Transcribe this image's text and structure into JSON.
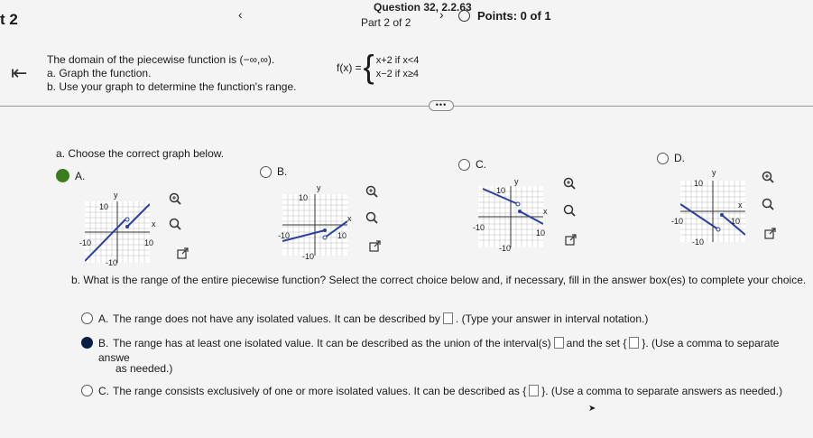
{
  "header": {
    "part_left": "t 2",
    "question": "Question 32, 2.2.63",
    "prev": "‹",
    "next": "›",
    "part": "Part 2 of 2",
    "points": "Points: 0 of 1"
  },
  "problem": {
    "line1": "The domain of the piecewise function is (−∞,∞).",
    "line2": "a. Graph the function.",
    "line3": "b. Use your graph to determine the function's range.",
    "fx": "f(x) =",
    "case1": "x+2  if  x<4",
    "case2": "x−2  if  x≥4"
  },
  "part_a": {
    "prompt": "a. Choose the correct graph below.",
    "options": [
      {
        "label": "A.",
        "state": "correct"
      },
      {
        "label": "B.",
        "state": "none"
      },
      {
        "label": "C.",
        "state": "none"
      },
      {
        "label": "D.",
        "state": "none"
      }
    ],
    "axis_y": "y",
    "axis_x": "x",
    "tick_pos": "10",
    "tick_neg": "-10"
  },
  "part_b": {
    "prompt": "b. What is the range of the entire piecewise function? Select the correct choice below and, if necessary, fill in the answer box(es) to complete your choice.",
    "A": {
      "label": "A.",
      "text1": "The range does not have any isolated values. It can be described by",
      "text2": ". (Type your answer in interval notation.)"
    },
    "B": {
      "label": "B.",
      "text1": "The range has at least one isolated value. It can be described as the union of the interval(s)",
      "text2": "and the set",
      "text3": ". (Use a comma to separate answe",
      "text4": "as needed.)"
    },
    "C": {
      "label": "C.",
      "text1": "The range consists exclusively of one or more isolated values. It can be described as",
      "text2": ". (Use a comma to separate answers as needed.)"
    }
  },
  "colors": {
    "graph_line": "#2a3f9e",
    "selected": "#0a1f44",
    "correct": "#3a7d1e"
  }
}
